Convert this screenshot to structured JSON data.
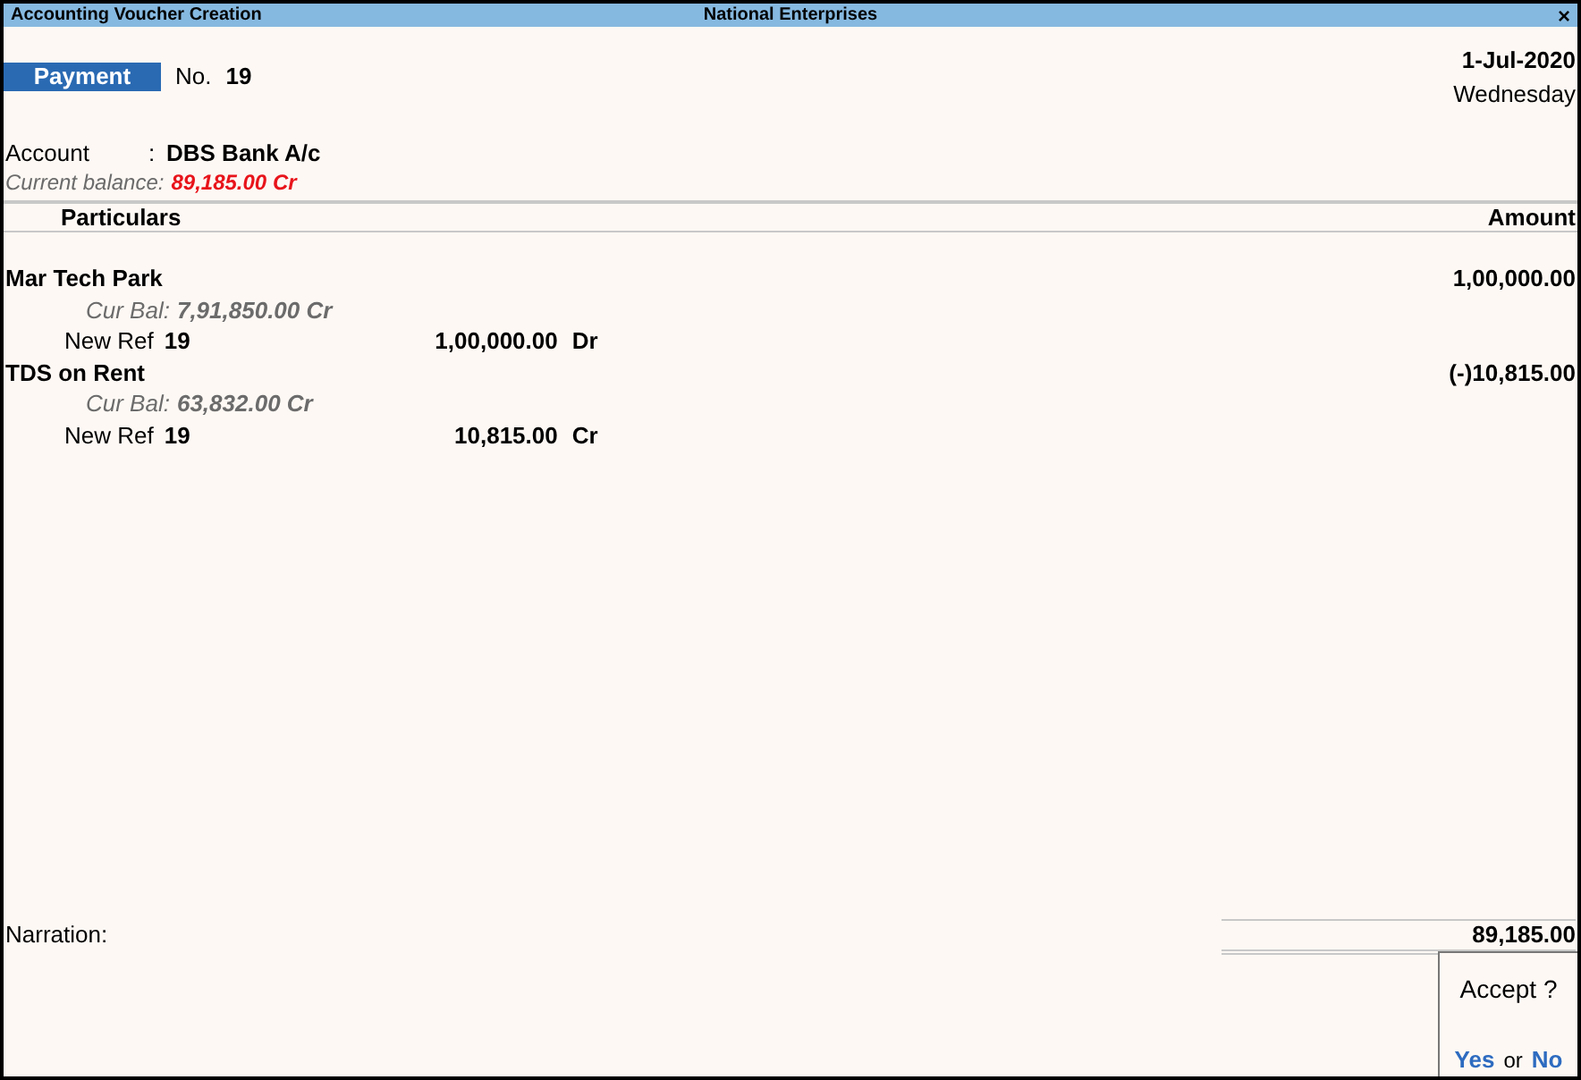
{
  "window": {
    "title": "Accounting Voucher  Creation",
    "company": "National Enterprises",
    "close": "×"
  },
  "voucher": {
    "type": "Payment",
    "number_label": "No.",
    "number": "19",
    "date": "1-Jul-2020",
    "weekday": "Wednesday"
  },
  "account": {
    "label": "Account",
    "separator": ":",
    "name": "DBS Bank A/c",
    "balance_label": "Current balance:",
    "balance": "89,185.00 Cr"
  },
  "table": {
    "columns": [
      "Particulars",
      "Amount"
    ],
    "rows": [
      {
        "ledger": "Mar Tech Park",
        "amount": "1,00,000.00",
        "cur_bal_label": "Cur Bal:",
        "cur_bal": "7,91,850.00 Cr",
        "ref_label": "New Ref",
        "ref": "19",
        "ref_amount": "1,00,000.00",
        "ref_side": "Dr"
      },
      {
        "ledger": "TDS on Rent",
        "amount": "(-)10,815.00",
        "cur_bal_label": "Cur Bal:",
        "cur_bal": "63,832.00 Cr",
        "ref_label": "New Ref",
        "ref": "19",
        "ref_amount": "10,815.00",
        "ref_side": "Cr"
      }
    ]
  },
  "narration": {
    "label": "Narration:"
  },
  "total": "89,185.00",
  "dialog": {
    "question": "Accept ?",
    "yes": "Yes",
    "or": "or",
    "no": "No"
  }
}
